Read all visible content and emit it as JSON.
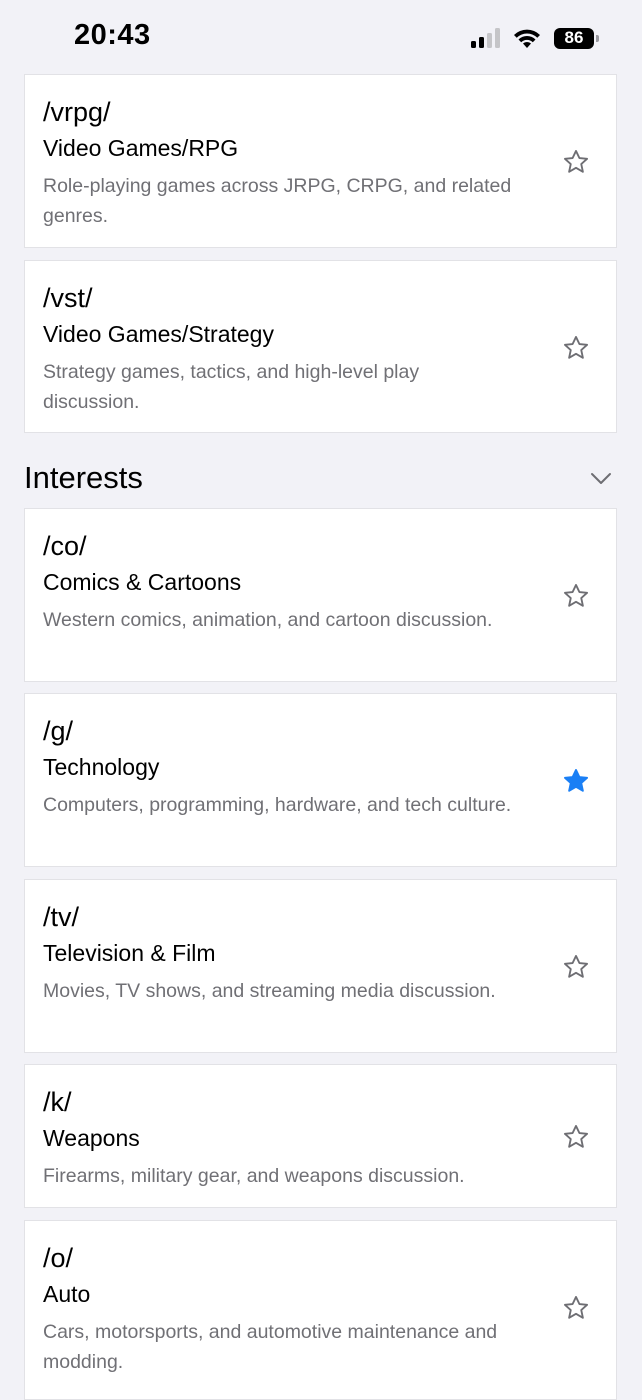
{
  "status_bar": {
    "time": "20:43",
    "battery": "86"
  },
  "colors": {
    "favorite_active": "#1a7ff5",
    "favorite_inactive": "#6e6e73",
    "description_text": "#707075",
    "background": "#f2f2f7"
  },
  "boards_top": [
    {
      "code": "/vrpg/",
      "title": "Video Games/RPG",
      "description": "Role-playing games across JRPG, CRPG, and related genres.",
      "favorite": false
    },
    {
      "code": "/vst/",
      "title": "Video Games/Strategy",
      "description": "Strategy games, tactics, and high-level play discussion.",
      "favorite": false
    }
  ],
  "interests": {
    "title": "Interests",
    "boards": [
      {
        "code": "/co/",
        "title": "Comics & Cartoons",
        "description": "Western comics, animation, and cartoon discussion.",
        "favorite": false
      },
      {
        "code": "/g/",
        "title": "Technology",
        "description": "Computers, programming, hardware, and tech culture.",
        "favorite": true
      },
      {
        "code": "/tv/",
        "title": "Television & Film",
        "description": "Movies, TV shows, and streaming media discussion.",
        "favorite": false
      },
      {
        "code": "/k/",
        "title": "Weapons",
        "description": "Firearms, military gear, and weapons discussion.",
        "favorite": false
      },
      {
        "code": "/o/",
        "title": "Auto",
        "description": "Cars, motorsports, and automotive maintenance and modding.",
        "favorite": false
      }
    ]
  }
}
